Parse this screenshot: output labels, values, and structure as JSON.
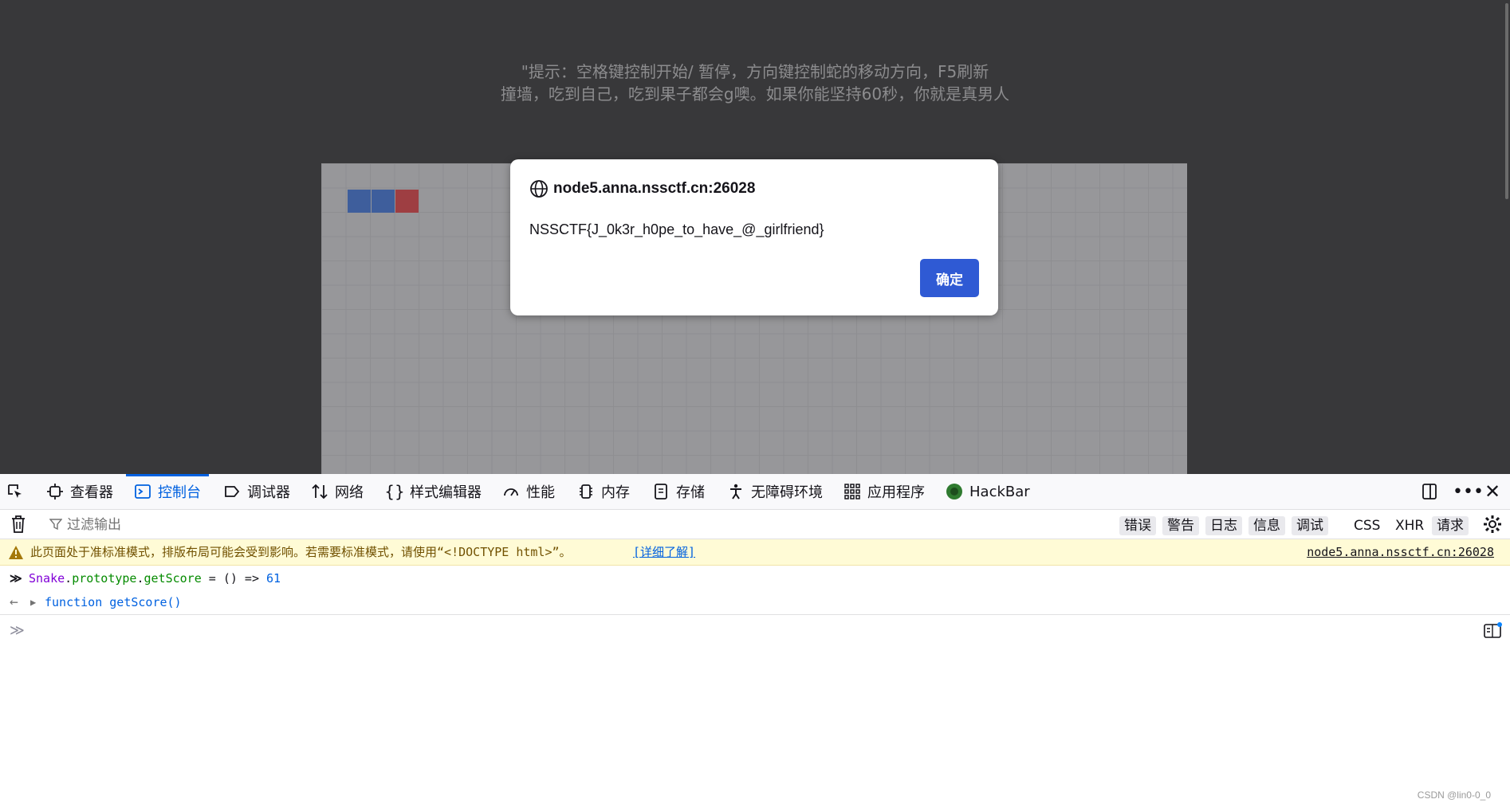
{
  "page": {
    "hint_line1": "\"提示：空格键控制开始/ 暂停，方向键控制蛇的移动方向，F5刷新",
    "hint_line2": "撞墙，吃到自己，吃到果子都会g噢。如果你能坚持60秒，你就是真男人"
  },
  "dialog": {
    "title": "node5.anna.nssctf.cn:26028",
    "message": "NSSCTF{J_0k3r_h0pe_to_have_@_girlfriend}",
    "ok_label": "确定"
  },
  "devtools": {
    "tabs": [
      {
        "label": "查看器",
        "icon": "inspector-icon"
      },
      {
        "label": "控制台",
        "icon": "console-icon",
        "active": true
      },
      {
        "label": "调试器",
        "icon": "debugger-icon"
      },
      {
        "label": "网络",
        "icon": "network-icon"
      },
      {
        "label": "样式编辑器",
        "icon": "style-editor-icon"
      },
      {
        "label": "性能",
        "icon": "performance-icon"
      },
      {
        "label": "内存",
        "icon": "memory-icon"
      },
      {
        "label": "存储",
        "icon": "storage-icon"
      },
      {
        "label": "无障碍环境",
        "icon": "accessibility-icon"
      },
      {
        "label": "应用程序",
        "icon": "application-icon"
      },
      {
        "label": "HackBar",
        "icon": "hackbar-icon"
      }
    ],
    "filter_placeholder": "过滤输出",
    "filter_buttons": [
      "错误",
      "警告",
      "日志",
      "信息",
      "调试"
    ],
    "type_buttons": [
      "CSS",
      "XHR",
      "请求"
    ],
    "warning": {
      "text": "此页面处于准标准模式，排版布局可能会受到影响。若需要标准模式，请使用“<!DOCTYPE html>”。",
      "link": "[详细了解]",
      "source": "node5.anna.nssctf.cn:26028"
    },
    "input": {
      "obj": "Snake",
      "p1": "prototype",
      "p2": "getScore",
      "rest": " = () => ",
      "num": "61"
    },
    "result": "function getScore()",
    "watermark": "CSDN @lin0-0_0"
  },
  "colors": {
    "accent": "#0061e0",
    "snake_body": "#3e5e9c",
    "snake_head": "#9e3e42",
    "dialog_button": "#2f5ad4"
  }
}
